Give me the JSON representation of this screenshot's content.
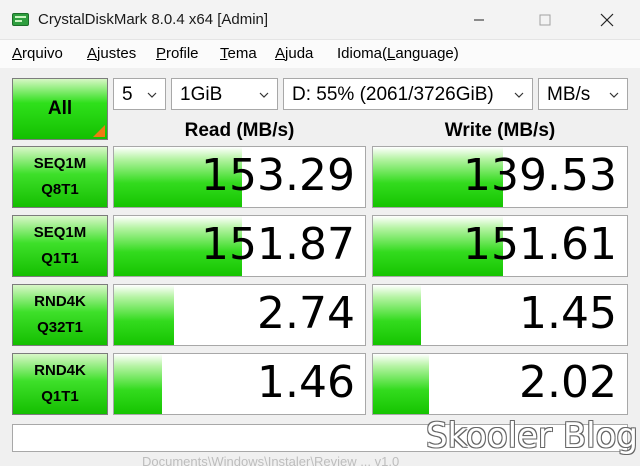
{
  "window": {
    "title": "CrystalDiskMark 8.0.4 x64 [Admin]",
    "icon": "crystaldiskmark-app-icon",
    "buttons": {
      "minimize": "minimize-icon",
      "maximize": "maximize-icon",
      "close": "close-icon"
    }
  },
  "menu": [
    {
      "label": "Arquivo",
      "underline": "A",
      "rest": "rquivo"
    },
    {
      "label": "Ajustes",
      "underline": "A",
      "rest": "justes"
    },
    {
      "label": "Profile",
      "underline": "P",
      "rest": "rofile"
    },
    {
      "label": "Tema",
      "underline": "T",
      "rest": "ema"
    },
    {
      "label": "Ajuda",
      "underline": "A",
      "rest": "juda"
    },
    {
      "label": "Idioma(Language)",
      "underline": "L",
      "pre": "Idioma(",
      "rest": "anguage)"
    }
  ],
  "controls": {
    "all_label": "All",
    "count": "5",
    "size": "1GiB",
    "drive": "D: 55% (2061/3726GiB)",
    "unit": "MB/s"
  },
  "headers": {
    "read": "Read (MB/s)",
    "write": "Write (MB/s)"
  },
  "tests": [
    {
      "line1": "SEQ1M",
      "line2": "Q8T1",
      "read": "153.29",
      "write": "139.53",
      "read_fill": 0.51,
      "write_fill": 0.51
    },
    {
      "line1": "SEQ1M",
      "line2": "Q1T1",
      "read": "151.87",
      "write": "151.61",
      "read_fill": 0.51,
      "write_fill": 0.51
    },
    {
      "line1": "RND4K",
      "line2": "Q32T1",
      "read": "2.74",
      "write": "1.45",
      "read_fill": 0.24,
      "write_fill": 0.19
    },
    {
      "line1": "RND4K",
      "line2": "Q1T1",
      "read": "1.46",
      "write": "2.02",
      "read_fill": 0.19,
      "write_fill": 0.22
    }
  ],
  "status": "",
  "watermark": "Skooler Blog",
  "footer_faint": "Documents\\Windows\\Instaler\\Review ... v1.0",
  "colors": {
    "accent_green": "#15c400",
    "corner_orange": "#ef7a12"
  }
}
